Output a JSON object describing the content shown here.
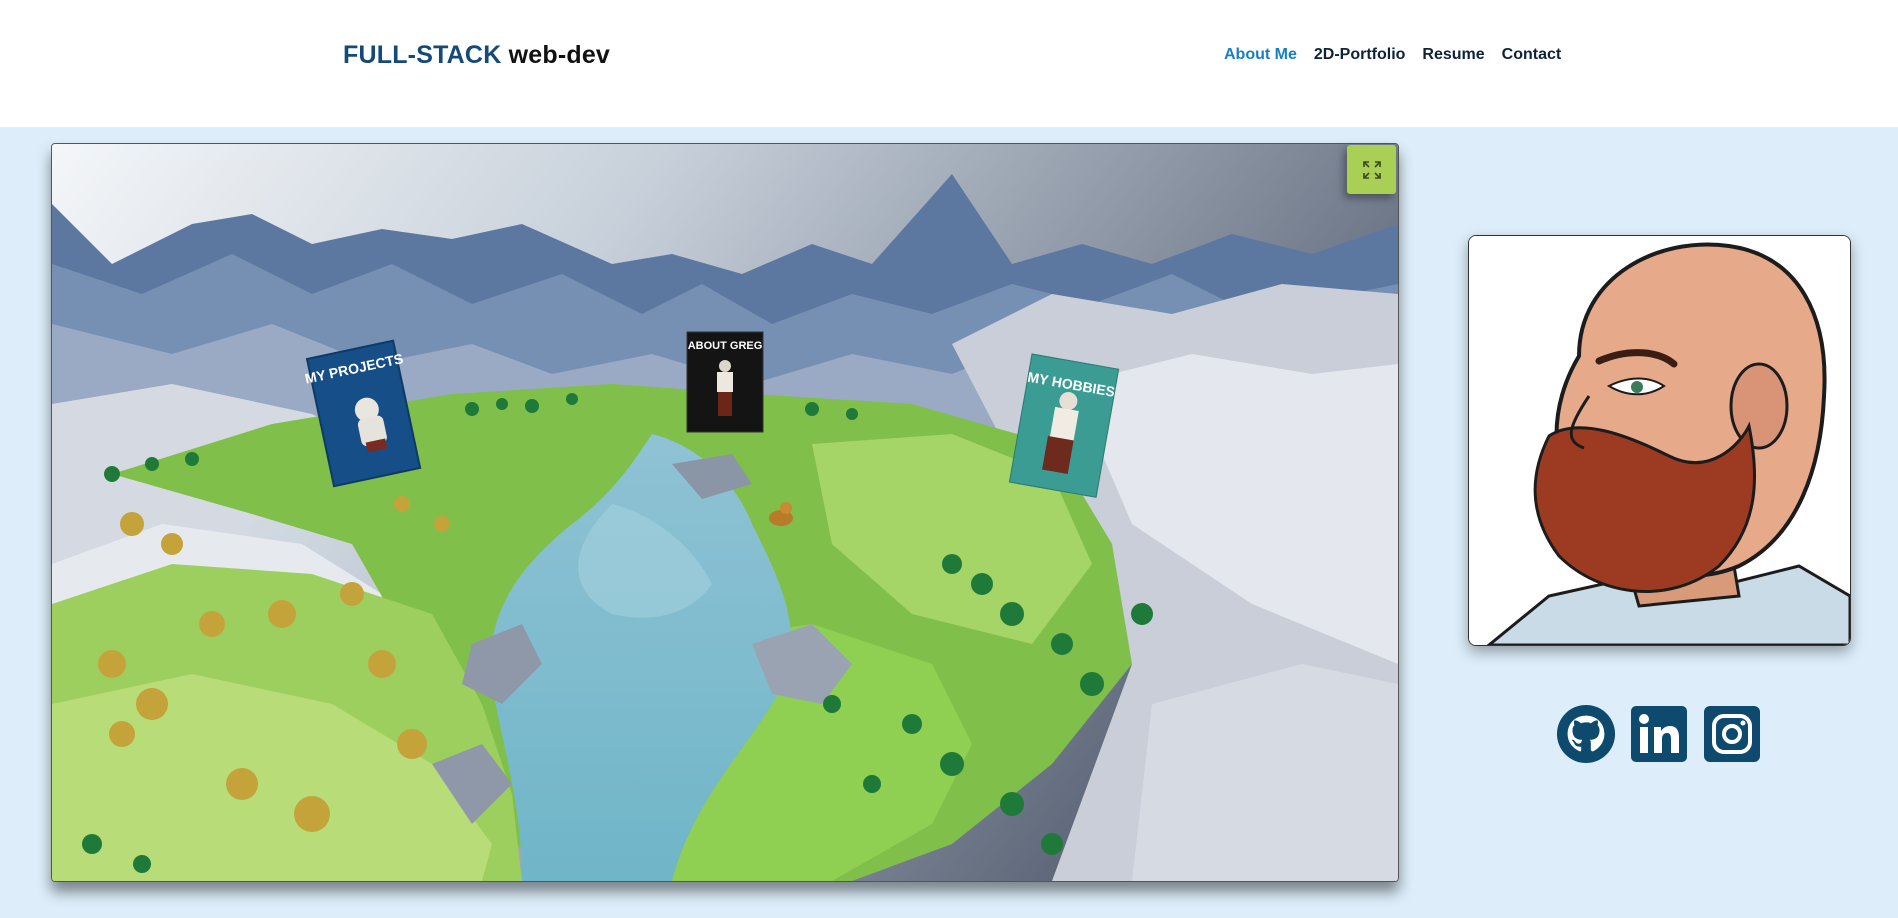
{
  "brand": {
    "part1": "FULL-STACK",
    "part2": "web-dev"
  },
  "nav": {
    "items": [
      {
        "label": "About Me",
        "active": true
      },
      {
        "label": "2D-Portfolio",
        "active": false
      },
      {
        "label": "Resume",
        "active": false
      },
      {
        "label": "Contact",
        "active": false
      }
    ]
  },
  "scene": {
    "signs": {
      "projects": "MY PROJECTS",
      "about": "ABOUT GREG",
      "hobbies": "MY HOBBIES"
    },
    "fullscreen_icon": "expand-icon"
  },
  "profile": {
    "image": "portrait-illustration"
  },
  "socials": [
    {
      "icon": "github-icon"
    },
    {
      "icon": "linkedin-icon"
    },
    {
      "icon": "instagram-icon"
    }
  ],
  "colors": {
    "page_bg": "#ddeefa",
    "brand_dark": "#154a78",
    "nav_active": "#1a7fc0",
    "fullscreen_btn": "#a9cf54",
    "social": "#0e4a6e"
  }
}
